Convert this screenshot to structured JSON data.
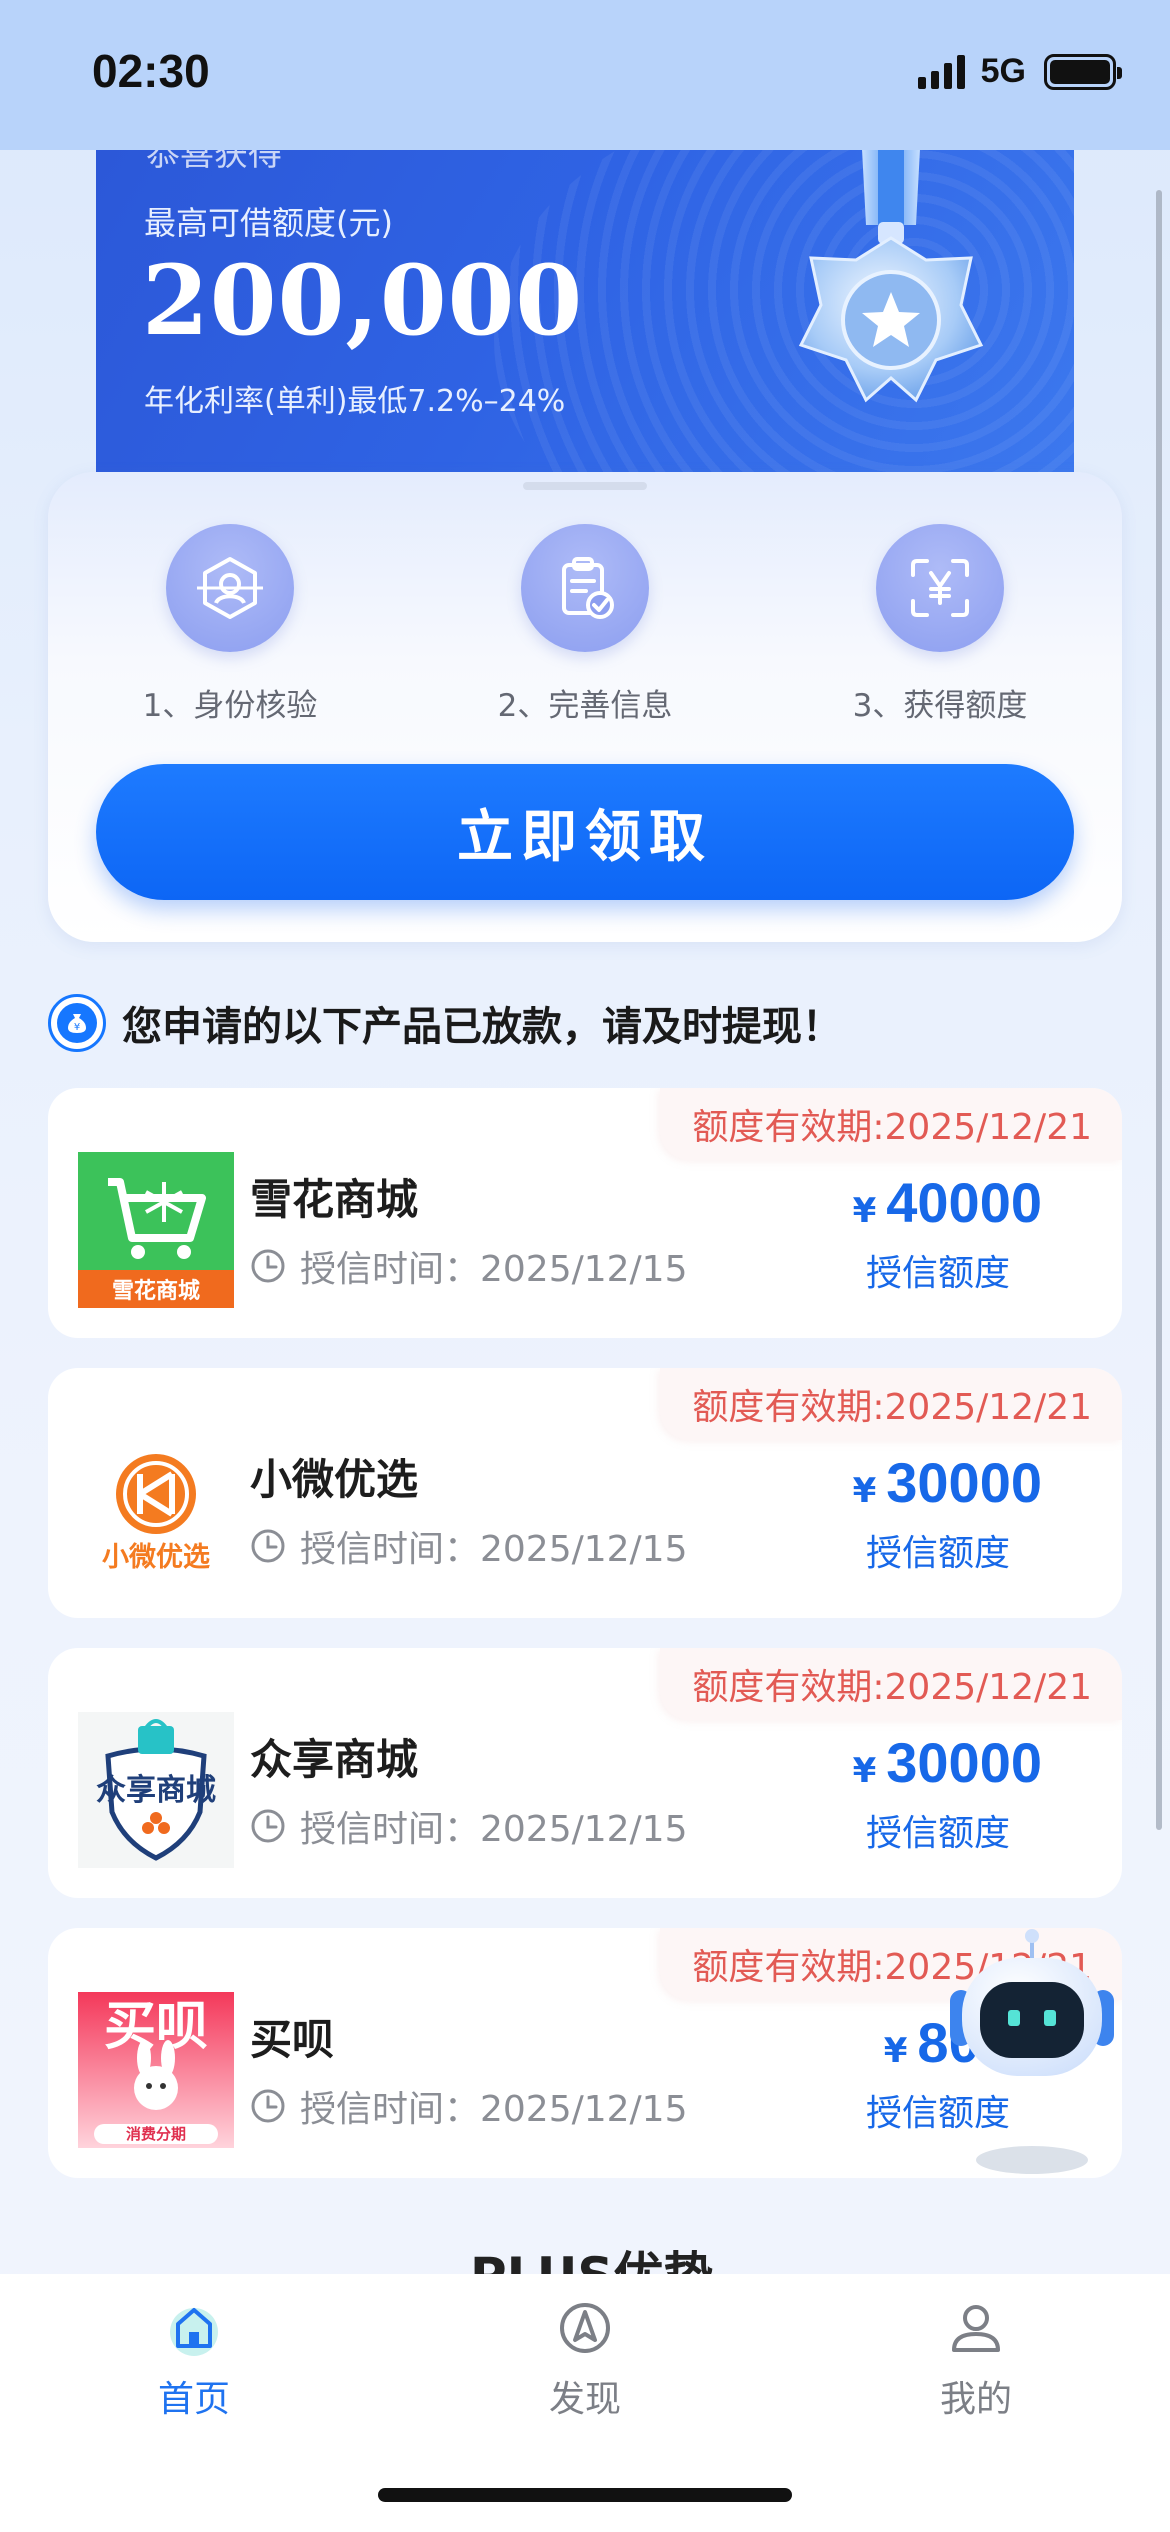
{
  "status_bar": {
    "time": "02:30",
    "network": "5G"
  },
  "banner": {
    "cutoff_text": "恭喜获得",
    "label": "最高可借额度(元)",
    "amount": "200,000",
    "rate": "年化利率(单利)最低7.2%–24%"
  },
  "steps": [
    {
      "label": "1、身份核验",
      "icon": "id-verify-icon"
    },
    {
      "label": "2、完善信息",
      "icon": "clipboard-check-icon"
    },
    {
      "label": "3、获得额度",
      "icon": "yuan-scan-icon"
    }
  ],
  "cta": {
    "label": "立即领取"
  },
  "section": {
    "title": "您申请的以下产品已放款，请及时提现！"
  },
  "products": [
    {
      "name": "雪花商城",
      "logo_text": "雪花商城",
      "expiry": "额度有效期:2025/12/21",
      "credit_time": "授信时间：2025/12/15",
      "currency": "¥",
      "amount": "40000",
      "amount_label": "授信额度"
    },
    {
      "name": "小微优选",
      "logo_text": "小微优选",
      "expiry": "额度有效期:2025/12/21",
      "credit_time": "授信时间：2025/12/15",
      "currency": "¥",
      "amount": "30000",
      "amount_label": "授信额度"
    },
    {
      "name": "众享商城",
      "logo_text": "众享商城",
      "expiry": "额度有效期:2025/12/21",
      "credit_time": "授信时间：2025/12/15",
      "currency": "¥",
      "amount": "30000",
      "amount_label": "授信额度"
    },
    {
      "name": "买呗",
      "logo_text": "买呗",
      "logo_sub": "消费分期",
      "expiry": "额度有效期:2025/12/21",
      "credit_time": "授信时间：2025/12/15",
      "currency": "¥",
      "amount": "8000",
      "amount_label": "授信额度"
    }
  ],
  "plus_heading": "PLUS优势",
  "tabs": [
    {
      "label": "首页",
      "icon": "home-icon",
      "active": true
    },
    {
      "label": "发现",
      "icon": "compass-icon",
      "active": false
    },
    {
      "label": "我的",
      "icon": "user-icon",
      "active": false
    }
  ],
  "colors": {
    "primary": "#1677FF",
    "expiry_red": "#E25A54",
    "amount_blue": "#1768E8"
  }
}
